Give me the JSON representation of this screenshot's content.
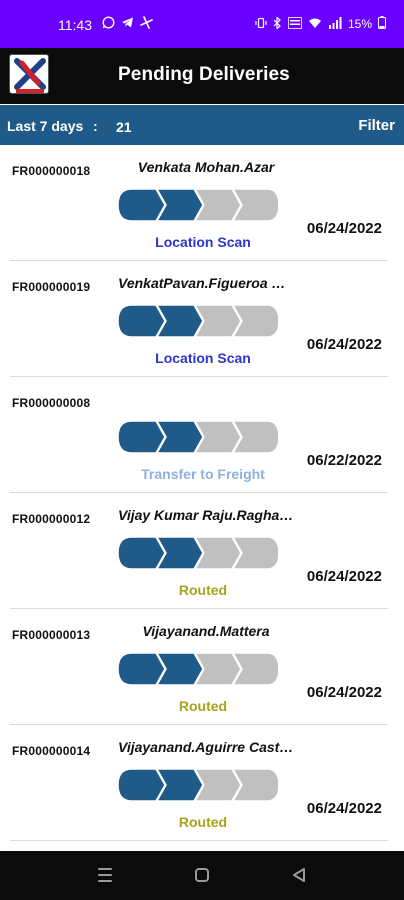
{
  "status_bar": {
    "time": "11:43",
    "battery": "15%",
    "left_icons": [
      "whatsapp-icon",
      "telegram-icon",
      "fan-icon"
    ],
    "right_icons": [
      "vibrate-icon",
      "bluetooth-icon",
      "volte-icon",
      "wifi-icon",
      "signal-icon",
      "battery-icon"
    ]
  },
  "app_bar": {
    "title": "Pending Deliveries",
    "logo_icon": "app-logo-x-icon"
  },
  "summary": {
    "range_label": "Last 7 days",
    "colon": ":",
    "count": "21",
    "filter_label": "Filter"
  },
  "colors": {
    "accent": "#1f5a88",
    "progress_done": "#1f5a88",
    "progress_pending": "#c0c0c0",
    "status_location_scan": "#2e36c8",
    "status_transfer": "#8fb1e0",
    "status_routed": "#a8a21c",
    "status_bar": "#6a00ff"
  },
  "deliveries": [
    {
      "id": "FR000000018",
      "name": "Venkata Mohan.Azar",
      "status": "Location Scan",
      "status_type": "location_scan",
      "date": "06/24/2022",
      "steps_completed": 2,
      "steps_total": 4
    },
    {
      "id": "FR000000019",
      "name": "VenkatPavan.Figueroa Gaspar",
      "status": "Location Scan",
      "status_type": "location_scan",
      "date": "06/24/2022",
      "steps_completed": 2,
      "steps_total": 4
    },
    {
      "id": "FR000000008",
      "name": "",
      "status": "Transfer to Freight",
      "status_type": "transfer",
      "date": "06/22/2022",
      "steps_completed": 2,
      "steps_total": 4
    },
    {
      "id": "FR000000012",
      "name": "Vijay Kumar Raju.Raghavan",
      "status": "Routed",
      "status_type": "routed",
      "date": "06/24/2022",
      "steps_completed": 2,
      "steps_total": 4
    },
    {
      "id": "FR000000013",
      "name": "Vijayanand.Mattera",
      "status": "Routed",
      "status_type": "routed",
      "date": "06/24/2022",
      "steps_completed": 2,
      "steps_total": 4
    },
    {
      "id": "FR000000014",
      "name": "Vijayanand.Aguirre Castillo",
      "status": "Routed",
      "status_type": "routed",
      "date": "06/24/2022",
      "steps_completed": 2,
      "steps_total": 4
    }
  ],
  "nav_bar": {
    "buttons": [
      "menu-icon",
      "home-icon",
      "back-icon"
    ]
  }
}
